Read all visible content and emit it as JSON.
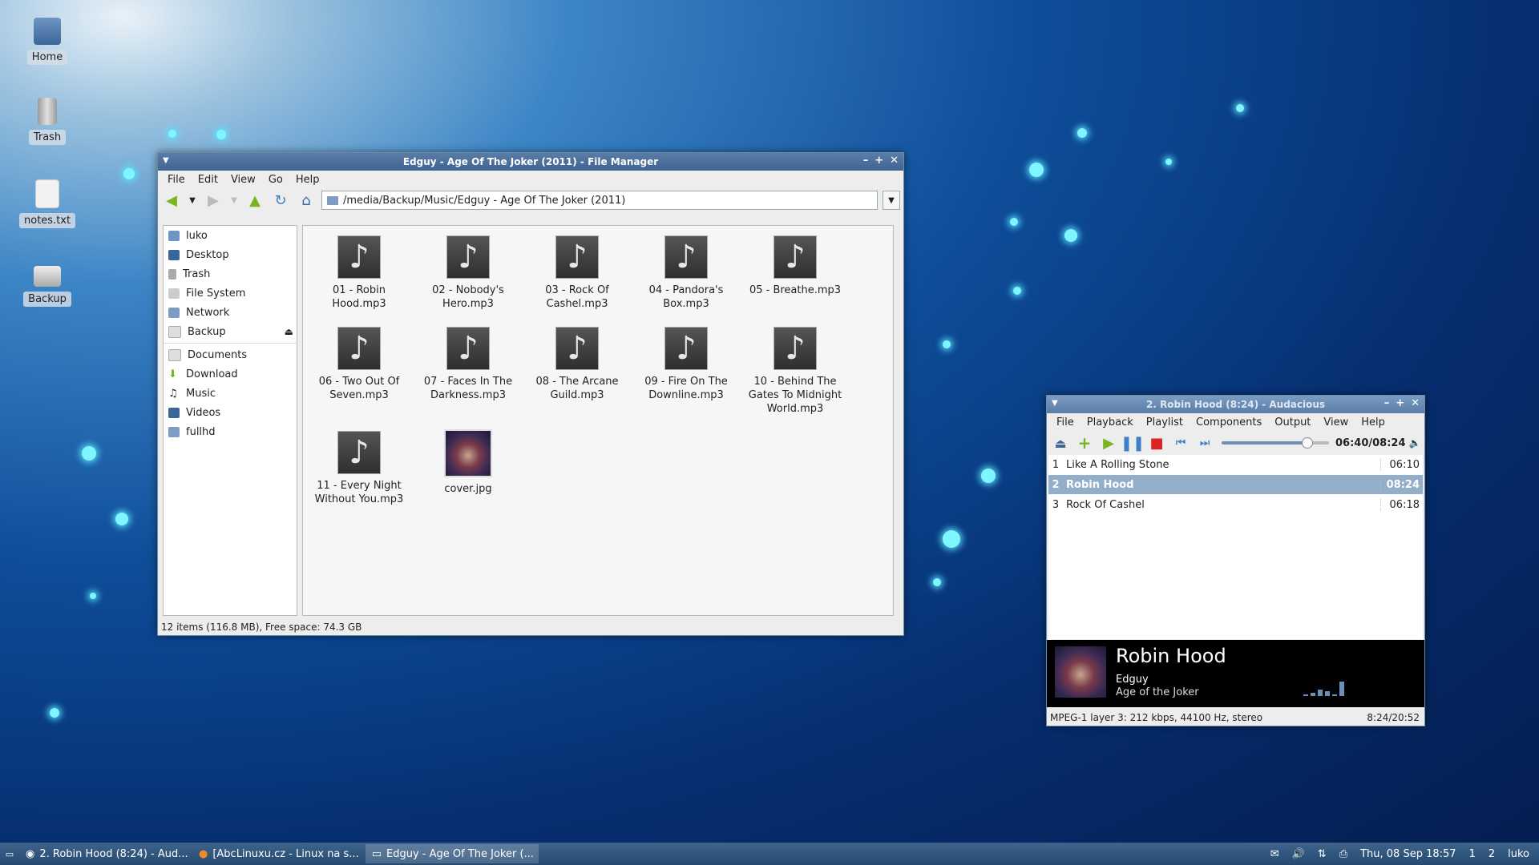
{
  "desktop": {
    "icons": [
      {
        "label": "Home",
        "icon": "home-folder-icon"
      },
      {
        "label": "Trash",
        "icon": "trash-icon"
      },
      {
        "label": "notes.txt",
        "icon": "text-file-icon"
      },
      {
        "label": "Backup",
        "icon": "drive-icon"
      }
    ]
  },
  "file_manager": {
    "title": "Edguy - Age Of The Joker (2011) - File Manager",
    "menu": [
      "File",
      "Edit",
      "View",
      "Go",
      "Help"
    ],
    "address": "/media/Backup/Music/Edguy - Age Of The Joker (2011)",
    "sidebar": [
      {
        "label": "luko",
        "icon": "home-icon"
      },
      {
        "label": "Desktop",
        "icon": "desktop-icon"
      },
      {
        "label": "Trash",
        "icon": "trash-icon"
      },
      {
        "label": "File System",
        "icon": "drive-icon"
      },
      {
        "label": "Network",
        "icon": "network-icon"
      },
      {
        "label": "Backup",
        "icon": "drive-icon"
      },
      {
        "label": "Documents",
        "icon": "folder-icon"
      },
      {
        "label": "Download",
        "icon": "download-icon"
      },
      {
        "label": "Music",
        "icon": "music-icon"
      },
      {
        "label": "Videos",
        "icon": "video-icon"
      },
      {
        "label": "fullhd",
        "icon": "folder-icon"
      }
    ],
    "files": [
      "01 - Robin Hood.mp3",
      "02 - Nobody's Hero.mp3",
      "03 - Rock Of Cashel.mp3",
      "04 - Pandora's Box.mp3",
      "05 - Breathe.mp3",
      "06 - Two Out Of Seven.mp3",
      "07 - Faces In The Darkness.mp3",
      "08 - The Arcane Guild.mp3",
      "09 - Fire On The Downline.mp3",
      "10 - Behind The Gates To Midnight World.mp3",
      "11 - Every Night Without You.mp3",
      "cover.jpg"
    ],
    "status": "12 items (116.8 MB), Free space: 74.3 GB"
  },
  "audacious": {
    "title": "2. Robin Hood (8:24) - Audacious",
    "menu": [
      "File",
      "Playback",
      "Playlist",
      "Components",
      "Output",
      "View",
      "Help"
    ],
    "time": "06:40/08:24",
    "seek_fraction": 0.79,
    "playlist": [
      {
        "num": "1",
        "title": "Like A Rolling Stone",
        "duration": "06:10"
      },
      {
        "num": "2",
        "title": "Robin Hood",
        "duration": "08:24"
      },
      {
        "num": "3",
        "title": "Rock Of Cashel",
        "duration": "06:18"
      }
    ],
    "now_playing": {
      "title": "Robin Hood",
      "artist": "Edguy",
      "album": "Age of the Joker"
    },
    "codec_info": "MPEG-1 layer 3: 212 kbps, 44100 Hz, stereo",
    "position_total": "8:24/20:52"
  },
  "taskbar": {
    "tasks": [
      "2. Robin Hood (8:24) - Aud...",
      "[AbcLinuxu.cz - Linux na s...",
      "Edguy - Age Of The Joker (..."
    ],
    "clock": "Thu, 08 Sep  18:57",
    "workspaces": [
      "1",
      "2"
    ],
    "user": "luko"
  }
}
